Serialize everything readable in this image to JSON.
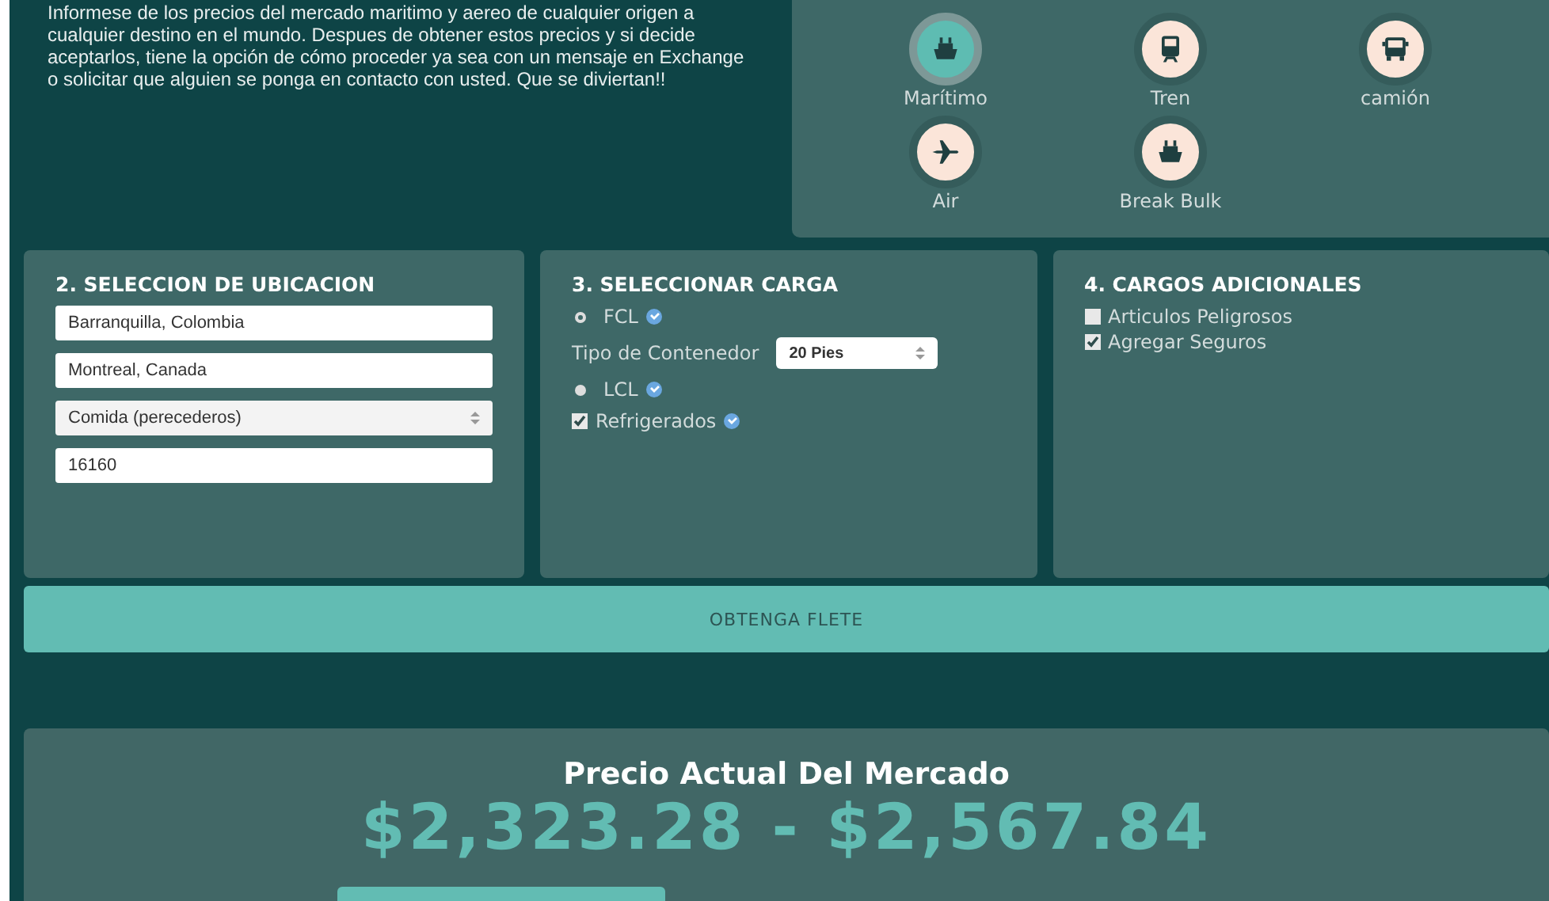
{
  "intro": {
    "text": "Informese de los precios del mercado maritimo y aereo de cualquier origen a cualquier destino en el mundo. Despues de obtener estos precios y si decide aceptarlos, tiene la opción de cómo proceder ya sea con un mensaje en Exchange o solicitar que alguien se ponga en contacto con usted. Que se diviertan!!"
  },
  "transport_modes": [
    {
      "label": "Marítimo",
      "kind": "ship",
      "selected": true
    },
    {
      "label": "Tren",
      "kind": "train",
      "selected": false
    },
    {
      "label": "camión",
      "kind": "truck",
      "selected": false
    },
    {
      "label": "Air",
      "kind": "plane",
      "selected": false
    },
    {
      "label": "Break Bulk",
      "kind": "ship",
      "selected": false
    }
  ],
  "location": {
    "title": "2. SELECCION DE UBICACION",
    "fields": [
      {
        "kind": "input",
        "value": "Barranquilla, Colombia"
      },
      {
        "kind": "input",
        "value": "Montreal, Canada"
      },
      {
        "kind": "select",
        "value": "Comida (perecederos)"
      },
      {
        "kind": "input",
        "value": "16160"
      }
    ]
  },
  "cargo": {
    "title": "3. SELECCIONAR CARGA",
    "items": [
      {
        "kind": "radio",
        "label": "FCL",
        "selected": true,
        "help": true
      },
      {
        "kind": "select",
        "label": "Tipo de Contenedor",
        "value": "20 Pies"
      },
      {
        "kind": "radio",
        "label": "LCL",
        "selected": false,
        "help": true
      },
      {
        "kind": "checkbox",
        "label": "Refrigerados",
        "checked": true,
        "help": true
      }
    ]
  },
  "extras": {
    "title": "4. CARGOS ADICIONALES",
    "items": [
      {
        "label": "Articulos Peligrosos",
        "checked": false
      },
      {
        "label": "Agregar Seguros",
        "checked": true
      }
    ]
  },
  "submit_button": "OBTENGA FLETE",
  "result": {
    "title": "Precio Actual Del Mercado",
    "price_range": "$2,323.28 - $2,567.84"
  }
}
